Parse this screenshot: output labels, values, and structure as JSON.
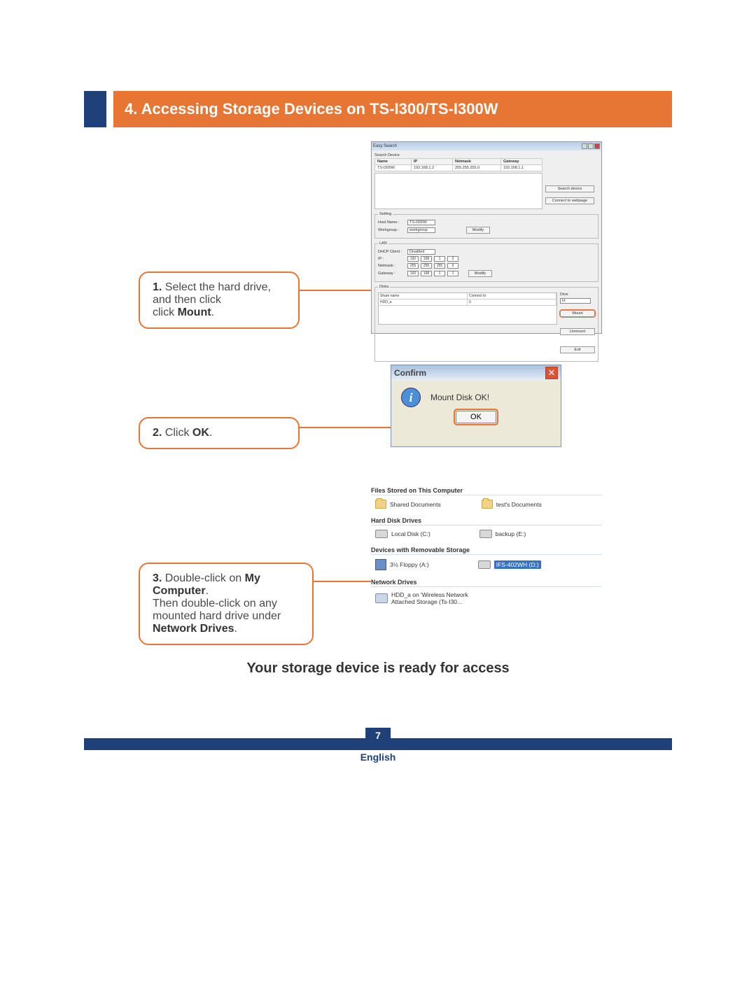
{
  "section_title": "4. Accessing Storage Devices on TS-I300/TS-I300W",
  "steps": {
    "s1": {
      "num": "1.",
      "text_a": " Select the hard drive, and then click ",
      "bold": "Mount",
      "text_b": "."
    },
    "s2": {
      "num": "2.",
      "text_a": " Click ",
      "bold": "OK",
      "text_b": "."
    },
    "s3": {
      "num": "3.",
      "line1_a": " Double-click on ",
      "line1_b": "My Computer",
      "line1_c": ". ",
      "line2_a": "Then double-click on any mounted hard drive under ",
      "line2_b": "Network Drives",
      "line2_c": "."
    }
  },
  "easy_search": {
    "title": "Easy Search",
    "section_search": "Search Device",
    "cols": {
      "name": "Name",
      "ip": "IP",
      "netmask": "Netmask",
      "gateway": "Gateway"
    },
    "row": {
      "name": "TS-I300W",
      "ip": "192.168.1.2",
      "netmask": "255.255.255.0",
      "gateway": "192.168.1.1"
    },
    "btn_search": "Search device",
    "btn_connect": "Connect to webpage",
    "setting": {
      "legend": "Setting",
      "hostname_lbl": "Host Name :",
      "hostname": "TS-I300W",
      "workgroup_lbl": "Workgroup :",
      "workgroup": "workgroup",
      "btn_modify": "Modify"
    },
    "lan": {
      "legend": "LAN",
      "dhcp_lbl": "DHCP Client :",
      "dhcp_val": "Disabled",
      "ip_lbl": "IP :",
      "ip": [
        "192",
        "168",
        "1",
        "2"
      ],
      "nm_lbl": "Netmask :",
      "nm": [
        "255",
        "255",
        "255",
        "0"
      ],
      "gw_lbl": "Gateway :",
      "gw": [
        "192",
        "168",
        "1",
        "1"
      ],
      "btn_modify": "Modify"
    },
    "disks": {
      "legend": "Disks",
      "col_share": "Share name",
      "col_conn": "Connect to",
      "row_share": "HDD_a",
      "row_conn": "0",
      "drive_lbl": "Drive",
      "drive_val": "H:",
      "btn_mount": "Mount",
      "btn_unmount": "Unmount",
      "btn_exit": "Exit"
    }
  },
  "confirm": {
    "title": "Confirm",
    "msg": "Mount Disk OK!",
    "ok": "OK"
  },
  "mycomputer": {
    "g1": "Files Stored on This Computer",
    "g1_items": [
      "Shared Documents",
      "test's Documents"
    ],
    "g2": "Hard Disk Drives",
    "g2_items": [
      "Local Disk (C:)",
      "backup (E:)"
    ],
    "g3": "Devices with Removable Storage",
    "g3_items": [
      "3½ Floppy (A:)",
      "IFS-402WH (D:)"
    ],
    "g4": "Network Drives",
    "g4_item_a": "HDD_a on 'Wireless Network",
    "g4_item_b": "Attached Storage (Ts-I30..."
  },
  "ready_msg": "Your storage device is ready for access",
  "page_number": "7",
  "language": "English"
}
